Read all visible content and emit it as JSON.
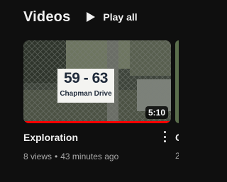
{
  "shelf": {
    "title": "Videos",
    "play_all_label": "Play all"
  },
  "video": {
    "thumbnail_sign_number": "59 - 63",
    "thumbnail_sign_street": "Chapman Drive",
    "duration": "5:10",
    "watch_progress": 1.0,
    "title": "Exploration",
    "views": "8 views",
    "separator": "•",
    "age": "43 minutes ago"
  },
  "next_video": {
    "title_fragment": "C",
    "meta_fragment": "2"
  },
  "colors": {
    "background": "#0f0f0f",
    "text_primary": "#f1f1f1",
    "text_secondary": "#aaaaaa",
    "progress_red": "#ff0000"
  },
  "icons": {
    "play_all": "play-icon",
    "menu": "more-vert-icon"
  }
}
